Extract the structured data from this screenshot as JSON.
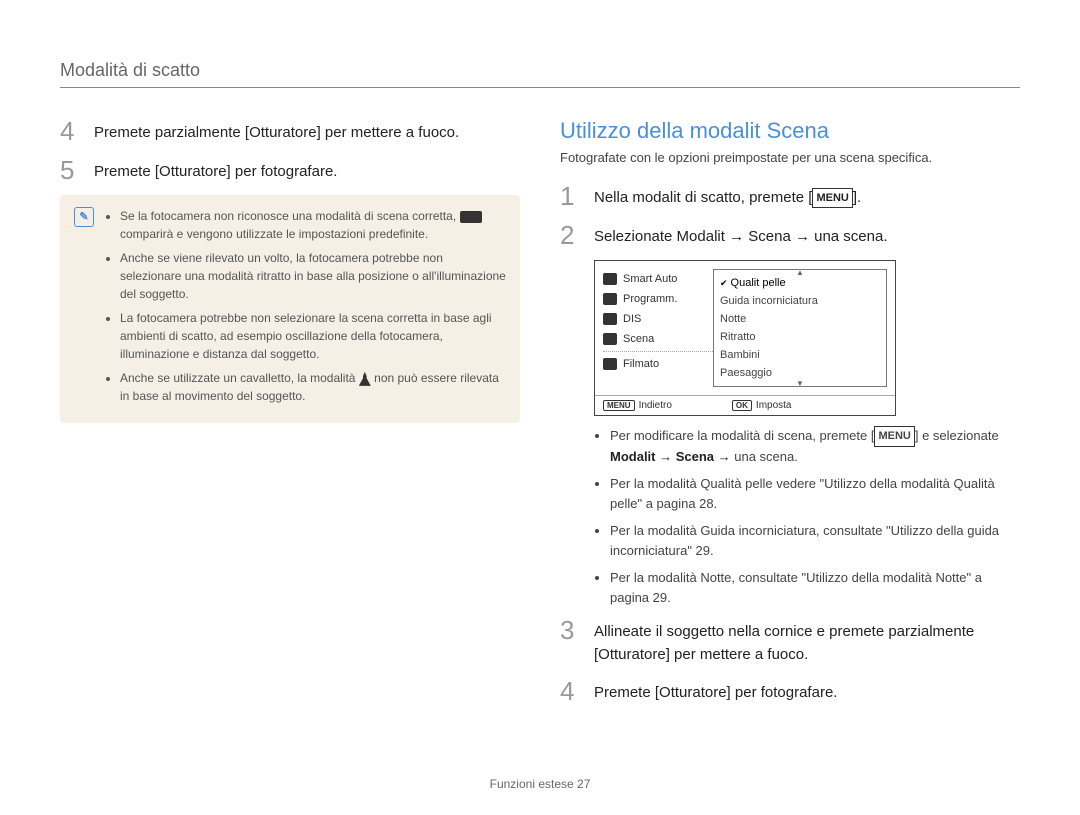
{
  "header": "Modalità di scatto",
  "left": {
    "steps": [
      {
        "num": "4",
        "text": "Premete parzialmente [Otturatore] per mettere a fuoco."
      },
      {
        "num": "5",
        "text": "Premete [Otturatore] per fotografare."
      }
    ],
    "notes": [
      {
        "pre": "Se la fotocamera non riconosce una modalità di scena corretta, ",
        "post": " comparirà e vengono utilizzate le impostazioni predefinite."
      },
      {
        "text": "Anche se viene rilevato un volto, la fotocamera potrebbe non selezionare una modalità ritratto in base alla posizione o all'illuminazione del soggetto."
      },
      {
        "text": "La fotocamera potrebbe non selezionare la scena corretta in base agli ambienti di scatto, ad esempio oscillazione della fotocamera, illuminazione e distanza dal soggetto."
      },
      {
        "pre": "Anche se utilizzate un cavalletto, la modalità ",
        "post": " non può essere rilevata in base al movimento del soggetto."
      }
    ]
  },
  "right": {
    "title": "Utilizzo della modalit  Scena",
    "intro": "Fotografate con le opzioni preimpostate per una scena specifica.",
    "step1": {
      "num": "1",
      "pre": "Nella modalit  di scatto, premete [",
      "menu": "MENU",
      "post": "]."
    },
    "step2": {
      "num": "2",
      "text": "Selezionate Modalit  → Scena → una scena."
    },
    "lcd": {
      "left_items": [
        "Smart Auto",
        "Programm.",
        "DIS",
        "Scena",
        "Filmato"
      ],
      "right_items": [
        "Qualit  pelle",
        "Guida incorniciatura",
        "Notte",
        "Ritratto",
        "Bambini",
        "Paesaggio"
      ],
      "footer": {
        "back_btn": "MENU",
        "back_label": "Indietro",
        "ok_btn": "OK",
        "ok_label": "Imposta"
      }
    },
    "bullets": [
      {
        "pre": "Per modificare la modalità di scena, premete [",
        "menu": "MENU",
        "mid": "] e selezionate ",
        "bold": "Modalit  → Scena →",
        "post": " una scena."
      },
      {
        "text": "Per la modalità Qualità pelle vedere \"Utilizzo della modalità Qualità pelle\" a pagina 28."
      },
      {
        "text": "Per la modalità Guida incorniciatura, consultate \"Utilizzo della guida incorniciatura\" 29."
      },
      {
        "text": "Per la modalità Notte, consultate \"Utilizzo della modalità Notte\" a pagina 29."
      }
    ],
    "step3": {
      "num": "3",
      "text": "Allineate il soggetto nella cornice e premete parzialmente [Otturatore] per mettere a fuoco."
    },
    "step4": {
      "num": "4",
      "text": "Premete [Otturatore] per fotografare."
    }
  },
  "footer": {
    "label": "Funzioni estese",
    "page": "27"
  }
}
